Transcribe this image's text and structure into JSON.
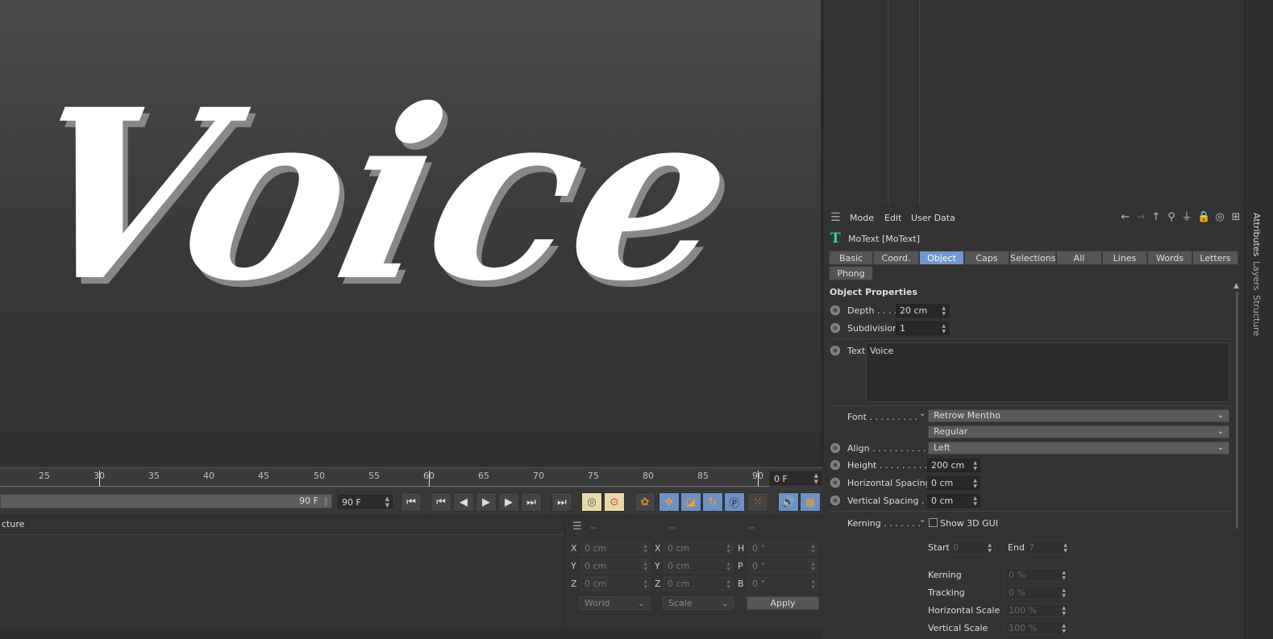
{
  "viewport": {
    "text": "Voice"
  },
  "timeline": {
    "ticks": [
      "25",
      "30",
      "35",
      "40",
      "45",
      "50",
      "55",
      "60",
      "65",
      "70",
      "75",
      "80",
      "85",
      "90"
    ],
    "current_frame_field": "0 F",
    "range_end": "90 F",
    "end_field": "90 F"
  },
  "bottom_left": {
    "header": "cture"
  },
  "coords": {
    "headers": [
      "--",
      "--",
      "--"
    ],
    "rows": [
      {
        "l1": "X",
        "v1": "0 cm",
        "l2": "X",
        "v2": "0 cm",
        "l3": "H",
        "v3": "0 °"
      },
      {
        "l1": "Y",
        "v1": "0 cm",
        "l2": "Y",
        "v2": "0 cm",
        "l3": "P",
        "v3": "0 °"
      },
      {
        "l1": "Z",
        "v1": "0 cm",
        "l2": "Z",
        "v2": "0 cm",
        "l3": "B",
        "v3": "0 °"
      }
    ],
    "space_dropdown": "World",
    "mode_dropdown": "Scale",
    "apply": "Apply"
  },
  "attributes": {
    "menu": {
      "mode": "Mode",
      "edit": "Edit",
      "user_data": "User Data"
    },
    "object_title": "MoText [MoText]",
    "tabs": [
      "Basic",
      "Coord.",
      "Object",
      "Caps",
      "Selections",
      "All",
      "Lines",
      "Words",
      "Letters"
    ],
    "tabs_row2": [
      "Phong"
    ],
    "active_tab": "Object",
    "section_title": "Object Properties",
    "depth": {
      "label": "Depth . . . .",
      "value": "20 cm"
    },
    "subdivision": {
      "label": "Subdivision",
      "value": "1"
    },
    "text": {
      "label": "Text",
      "value": "Voice"
    },
    "font": {
      "label": "Font . . . . . . . . .",
      "family": "Retrow Mentho",
      "style": "Regular"
    },
    "align": {
      "label": "Align . . . . . . . . . .",
      "value": "Left"
    },
    "height": {
      "label": "Height . . . . . . . . .",
      "value": "200 cm"
    },
    "horizontal_spacing": {
      "label": "Horizontal Spacing",
      "value": "0 cm"
    },
    "vertical_spacing": {
      "label": "Vertical Spacing . .",
      "value": "0 cm"
    },
    "kerning": {
      "label": "Kerning . . . . . . .",
      "show_3d_gui": "Show 3D GUI"
    },
    "start": {
      "label": "Start",
      "value": "0"
    },
    "end": {
      "label": "End",
      "value": "7"
    },
    "kerning_value": {
      "label": "Kerning",
      "value": "0 %"
    },
    "tracking": {
      "label": "Tracking",
      "value": "0 %"
    },
    "horizontal_scale": {
      "label": "Horizontal Scale",
      "value": "100 %"
    },
    "vertical_scale": {
      "label": "Vertical Scale",
      "value": "100 %"
    }
  },
  "side_tabs": [
    "Attributes",
    "Layers",
    "Structure"
  ]
}
